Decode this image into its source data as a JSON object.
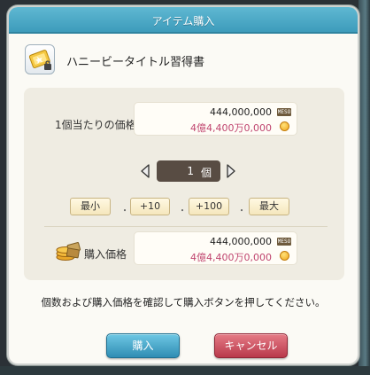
{
  "window": {
    "title": "アイテム購入"
  },
  "item": {
    "name": "ハニービータイトル習得書",
    "icon": "scroll-book-icon"
  },
  "unit_price": {
    "label": "1個当たりの価格",
    "amount": "444,000,000",
    "amount_jp": "4億4,400万0,000",
    "currency_badge": "MESO"
  },
  "quantity": {
    "value": "1",
    "unit": "個"
  },
  "steppers": {
    "min": "最小",
    "plus10": "+10",
    "plus100": "+100",
    "max": "最大"
  },
  "total_price": {
    "label": "購入価格",
    "amount": "444,000,000",
    "amount_jp": "4億4,400万0,000",
    "currency_badge": "MESO"
  },
  "instruction": "個数および購入価格を確認して購入ボタンを押してください。",
  "buttons": {
    "buy": "購入",
    "cancel": "キャンセル"
  },
  "colors": {
    "title_bar": "#4aa8c6",
    "price_jp_text": "#c0456f",
    "buy_button": "#3a9cc2",
    "cancel_button": "#c94a5a"
  }
}
